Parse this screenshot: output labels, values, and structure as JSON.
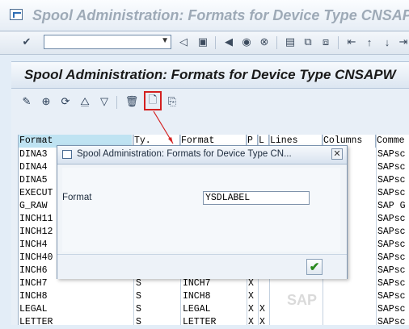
{
  "window": {
    "title": "Spool Administration: Formats for Device Type CNSAP"
  },
  "toolbar": {
    "command_value": ""
  },
  "app": {
    "title": "Spool Administration: Formats for Device Type CNSAPW"
  },
  "table": {
    "headers": [
      "Format",
      "Ty.",
      "Format",
      "P",
      "L",
      "Lines",
      "Columns",
      "Comme"
    ],
    "rows": [
      {
        "format": "DINA3",
        "comment": "SAPsc"
      },
      {
        "format": "DINA4",
        "comment": "SAPsc"
      },
      {
        "format": "DINA5",
        "comment": "SAPsc"
      },
      {
        "format": "EXECUT",
        "comment": "SAPsc"
      },
      {
        "format": "G_RAW",
        "comment": "SAP G"
      },
      {
        "format": "INCH11",
        "comment": "SAPsc"
      },
      {
        "format": "INCH12",
        "comment": "SAPsc"
      },
      {
        "format": "INCH4",
        "comment": "SAPsc"
      },
      {
        "format": "INCH40",
        "comment": "SAPsc"
      },
      {
        "format": "INCH6",
        "comment": "SAPsc"
      },
      {
        "format": "INCH7",
        "type": "S",
        "format2": "INCH7",
        "p": "X",
        "l": "",
        "comment": "SAPsc"
      },
      {
        "format": "INCH8",
        "type": "S",
        "format2": "INCH8",
        "p": "X",
        "l": "",
        "comment": "SAPsc"
      },
      {
        "format": "LEGAL",
        "type": "S",
        "format2": "LEGAL",
        "p": "X",
        "l": "X",
        "comment": "SAPsc"
      },
      {
        "format": "LETTER",
        "type": "S",
        "format2": "LETTER",
        "p": "X",
        "l": "X",
        "comment": "SAPsc"
      }
    ]
  },
  "dialog": {
    "title": "Spool Administration: Formats for Device Type CN...",
    "format_label": "Format",
    "format_value": "YSDLABEL",
    "close_glyph": "✕",
    "ok_glyph": "✔"
  },
  "watermark": "SAP",
  "colors": {
    "highlight": "#d42020",
    "background": "#e3edf7"
  }
}
